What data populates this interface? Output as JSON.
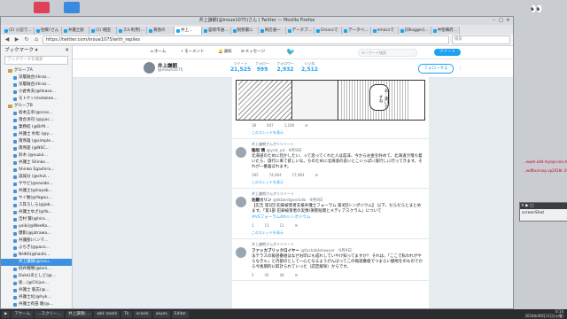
{
  "desktop": {
    "icons": [
      {
        "label": "",
        "color": "#e0405a"
      },
      {
        "label": "",
        "color": "#3a8be0"
      }
    ]
  },
  "window": {
    "title": "井上謙朗(@inoue1075)さん | Twitter — Mozilla Firefox"
  },
  "tabs": [
    {
      "label": "(2) 小説で…"
    },
    {
      "label": "住職?さん"
    },
    {
      "label": "弁護士鋭"
    },
    {
      "label": "(1) 増田"
    },
    {
      "label": "スル利用(…"
    },
    {
      "label": "黄昏の"
    },
    {
      "label": "井上…",
      "active": true
    },
    {
      "label": "盛岡市通…"
    },
    {
      "label": "税務署に"
    },
    {
      "label": "商店通一"
    },
    {
      "label": "データブ…"
    },
    {
      "label": "Emacsで"
    },
    {
      "label": "データベ…"
    },
    {
      "label": "emacsで"
    },
    {
      "label": "[[Blogger]…"
    },
    {
      "label": "中堅幕府…"
    }
  ],
  "nav": {
    "back": "◀",
    "forward": "▶",
    "reload": "↻",
    "home": "⌂",
    "url": "https://twitter.com/inoue1075/with_replies",
    "search_placeholder": "検索"
  },
  "sidebar": {
    "title": "ブックマーク ▾",
    "close": "✕",
    "search_placeholder": "ブックマークを検索",
    "items": [
      {
        "label": "グループA",
        "type": "folder"
      },
      {
        "label": "深層融合(Hiraz…",
        "type": "item"
      },
      {
        "label": "深層融合(Hiraz…",
        "type": "item"
      },
      {
        "label": "小倉秀夫(@hkasa…",
        "type": "item"
      },
      {
        "label": "モトケン(motoken…",
        "type": "item"
      },
      {
        "label": "グループB",
        "type": "folder"
      },
      {
        "label": "坂本正幸(@zcos…",
        "type": "item"
      },
      {
        "label": "落合洋司 (@yjoc…",
        "type": "item"
      },
      {
        "label": "業務結 (@BrM…",
        "type": "item"
      },
      {
        "label": "弁護士 杉松 (@y…",
        "type": "item"
      },
      {
        "label": "南燕雄 (@simple…",
        "type": "item"
      },
      {
        "label": "南燕座 (@NSC…",
        "type": "item"
      },
      {
        "label": "鈴木 (@suzul…",
        "type": "item"
      },
      {
        "label": "弁護士 Shinko…",
        "type": "item"
      },
      {
        "label": "Shinko Egashira…",
        "type": "item"
      },
      {
        "label": "談誠分 (@shut…",
        "type": "item"
      },
      {
        "label": "ササビ(@sasabi…",
        "type": "item"
      },
      {
        "label": "弁護士(@hayab…",
        "type": "item"
      },
      {
        "label": "ヤイ勉(@Yagou…",
        "type": "item"
      },
      {
        "label": "ス其ろしら(@jab…",
        "type": "item"
      },
      {
        "label": "弁護士ゆざ(@Ya…",
        "type": "item"
      },
      {
        "label": "吉村 賢(@hiro…",
        "type": "item"
      },
      {
        "label": "yoiki(@WeeKa…",
        "type": "item"
      },
      {
        "label": "爆影(@jatrawa…",
        "type": "item"
      },
      {
        "label": "弁護部(ハンマ…",
        "type": "item"
      },
      {
        "label": "ぶちぎ(@paco…",
        "type": "item"
      },
      {
        "label": "NHKA(@hashi…",
        "type": "item"
      },
      {
        "label": "井上謙朗(@inou…",
        "type": "item",
        "selected": true
      },
      {
        "label": "刑弁戦略(@keii…",
        "type": "item"
      },
      {
        "label": "Duke(あとしど(@…",
        "type": "item"
      },
      {
        "label": "坂…(@Chijun…",
        "type": "item"
      },
      {
        "label": "弁護士 聡志(@…",
        "type": "item"
      },
      {
        "label": "弁護士化(@hyk…",
        "type": "item"
      },
      {
        "label": "弁護士有田 駿(@…",
        "type": "item"
      },
      {
        "label": "山田 (@ayio…",
        "type": "item"
      },
      {
        "label": "三十世(@ok…",
        "type": "item"
      }
    ]
  },
  "twitter": {
    "nav": {
      "home": "ホーム",
      "moments": "モーメント",
      "notifications": "通知",
      "messages": "メッセージ",
      "bird": "🐦",
      "search_placeholder": "キーワード検索",
      "tweet_button": "ツイート"
    },
    "profile": {
      "name": "井上謙朗",
      "handle": "@inoue1075",
      "stats": [
        {
          "label": "ツイート",
          "value": "21,525"
        },
        {
          "label": "フォロー",
          "value": "999"
        },
        {
          "label": "フォロワー",
          "value": "2,932"
        },
        {
          "label": "いいね",
          "value": "2,512"
        }
      ],
      "follow_button": "フォローする",
      "more": "⋮"
    },
    "tweets": [
      {
        "kind": "image",
        "bubble": "あ…凄いですね",
        "actions": [
          "38",
          "647",
          "1,260",
          "✉"
        ],
        "thread": "このスレッドを表示"
      },
      {
        "retweeted_by": "井上謙朗さんがリツイート",
        "name": "稲垣 晴",
        "handle": "@ynd_yd · 9月9日",
        "text": "北海道のために何かしたい、って思ってくれた人は是非、今からお金を貯めて、北海道が落ち着いたら、旅行に来て欲しいな。ちのために北海道の良いとこいっぱい旅行しに行ってきます。それが一番喜ばれます。",
        "actions": [
          "185",
          "74,064",
          "17,964",
          "✉"
        ],
        "thread": "このスレッドを表示"
      },
      {
        "retweeted_by": "井上謙朗さんがリツイート",
        "name": "佐藤カリン",
        "handle": "@tkbkrdgovilutb · 9月9日",
        "text": "【広告 第1回 犯罪被害者支援弁護士フォーラム 第4回シンポジウム】 以下、だらだらとまとめ ます。「第1部 犯罪被害者の実像/損害賠償とメディアスクラム」について",
        "link": "#VSフォーラム4thシンポジウム",
        "actions": [
          "1",
          "15",
          "11",
          "✉"
        ],
        "thread": "このスレッドを表示"
      },
      {
        "retweeted_by": "井上謙朗さんがリツイート",
        "name": "ファッカブリックロイヤー",
        "handle": "@fuckablelawyer · 9月9日",
        "text": "法テラスの報道番組はなぜお叩にも成れしていやけ知ってますか？ それは、「ここで私われがやらなきゃ」と内部のとして一心となるようがんばってこの報道番組でつまらい額地をのものでから今後期的に取計られていった（認定解除）からです。",
        "actions": [
          "5",
          "45",
          "46",
          "✉"
        ],
        "thread": ""
      }
    ]
  },
  "taskbar": {
    "items": [
      "▶",
      "アクーム",
      "…スクリー…",
      "井上謙朗(…",
      "wbl: bashi",
      "Tk",
      "xclock",
      "xeyes",
      "Editor"
    ],
    "clock_time": "0:14",
    "clock_date": "2018年09月11日(火曜)"
  },
  "right_pane": {
    "eyes": "👀",
    "lines": [
      "…ww/k-add-mysql-unix.ht…",
      "…wdfbcsrvxp.vp2018c 2019フ…"
    ],
    "gtask": {
      "title": "✕ ▶ □",
      "label": "screenShot"
    }
  }
}
